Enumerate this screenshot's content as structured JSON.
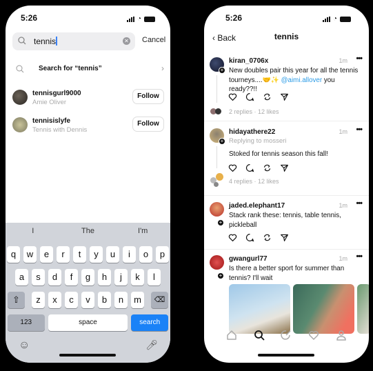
{
  "status_bar": {
    "time": "5:26"
  },
  "search_screen": {
    "query": "tennis",
    "cancel_label": "Cancel",
    "search_for_label": "Search for “tennis”",
    "results": [
      {
        "username": "tennisgurl9000",
        "subtitle": "Amie Oliver",
        "button": "Follow"
      },
      {
        "username": "tennisislyfe",
        "subtitle": "Tennis with Dennis",
        "button": "Follow"
      }
    ],
    "keyboard": {
      "suggestions": [
        "I",
        "The",
        "I'm"
      ],
      "row1": [
        "q",
        "w",
        "e",
        "r",
        "t",
        "y",
        "u",
        "i",
        "o",
        "p"
      ],
      "row2": [
        "a",
        "s",
        "d",
        "f",
        "g",
        "h",
        "j",
        "k",
        "l"
      ],
      "row3": [
        "z",
        "x",
        "c",
        "v",
        "b",
        "n",
        "m"
      ],
      "numbers_label": "123",
      "space_label": "space",
      "search_label": "search"
    }
  },
  "results_screen": {
    "back_label": "Back",
    "title": "tennis",
    "posts": [
      {
        "username": "kiran_0706x",
        "time": "1m",
        "text_pre": "New doubles pair this year for all the tennis tourneys....🤝✨ ",
        "mention": "@aimi.allover",
        "text_post": " you ready??!!",
        "stats": "2 replies · 12 likes"
      },
      {
        "username": "hidayathere22",
        "time": "1m",
        "replying": "Replying to mosseri",
        "text": "Stoked for tennis season this fall!",
        "stats": "4 replies · 12 likes"
      },
      {
        "username": "jaded.elephant17",
        "time": "1m",
        "text": "Stack rank these: tennis, table tennis, pickleball"
      },
      {
        "username": "gwangurl77",
        "time": "1m",
        "text": "Is there a better sport for summer than tennis? I'll wait"
      }
    ],
    "tabs": [
      "home",
      "search",
      "compose",
      "activity",
      "profile"
    ]
  }
}
